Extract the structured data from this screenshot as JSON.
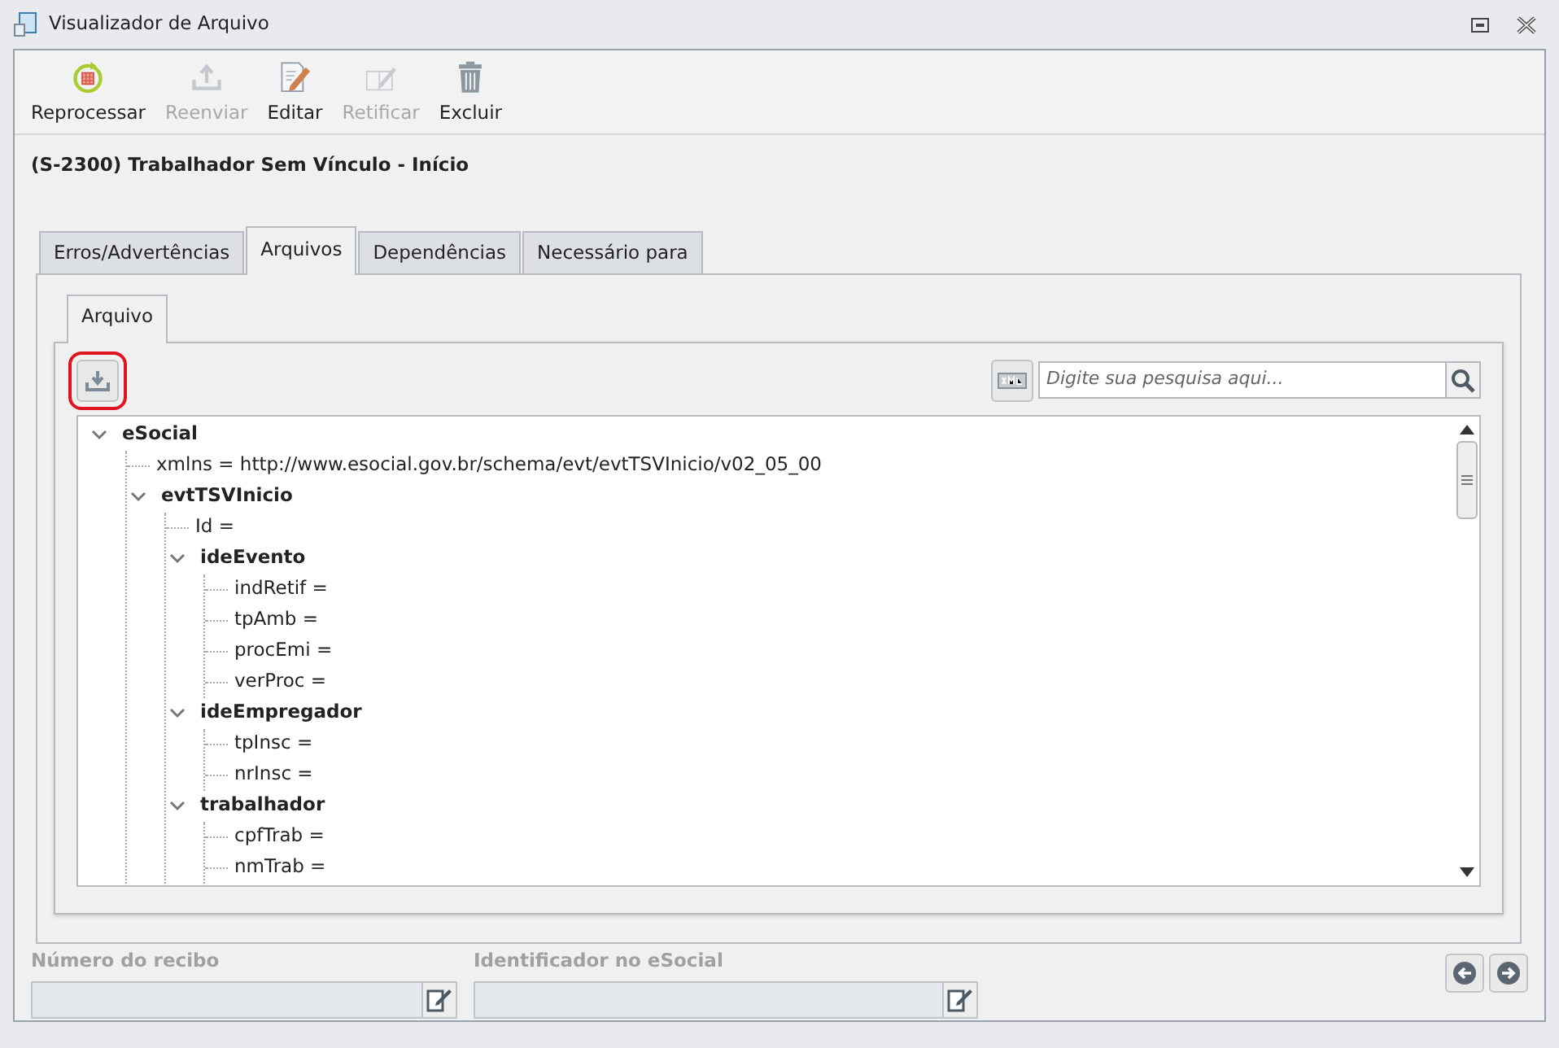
{
  "window": {
    "title": "Visualizador de Arquivo"
  },
  "toolbar": [
    {
      "kind": "reprocess",
      "label": "Reprocessar",
      "disabled": false
    },
    {
      "kind": "upload",
      "label": "Reenviar",
      "disabled": true
    },
    {
      "kind": "edit",
      "label": "Editar",
      "disabled": false
    },
    {
      "kind": "rectify",
      "label": "Retificar",
      "disabled": true
    },
    {
      "kind": "delete",
      "label": "Excluir",
      "disabled": false
    }
  ],
  "heading": "(S-2300) Trabalhador Sem Vínculo - Início",
  "tabs": [
    {
      "label": "Erros/Advertências",
      "selected": false
    },
    {
      "label": "Arquivos",
      "selected": true
    },
    {
      "label": "Dependências",
      "selected": false
    },
    {
      "label": "Necessário para",
      "selected": false
    }
  ],
  "inner_tabs": [
    {
      "label": "Arquivo",
      "selected": true
    }
  ],
  "search": {
    "placeholder": "Digite sua pesquisa aqui..."
  },
  "tree": [
    {
      "label": "eSocial",
      "expanded": true,
      "children": [
        {
          "label": "xmlns = http://www.esocial.gov.br/schema/evt/evtTSVInicio/v02_05_00"
        },
        {
          "label": "evtTSVInicio",
          "expanded": true,
          "children": [
            {
              "label": "Id ="
            },
            {
              "label": "ideEvento",
              "expanded": true,
              "children": [
                {
                  "label": "indRetif ="
                },
                {
                  "label": "tpAmb ="
                },
                {
                  "label": "procEmi ="
                },
                {
                  "label": "verProc ="
                }
              ]
            },
            {
              "label": "ideEmpregador",
              "expanded": true,
              "children": [
                {
                  "label": "tpInsc ="
                },
                {
                  "label": "nrInsc ="
                }
              ]
            },
            {
              "label": "trabalhador",
              "expanded": true,
              "children": [
                {
                  "label": "cpfTrab ="
                },
                {
                  "label": "nmTrab ="
                }
              ]
            }
          ]
        }
      ]
    }
  ],
  "fields": [
    {
      "label": "Número do recibo",
      "disabled": true
    },
    {
      "label": "Identificador no eSocial",
      "disabled": true
    }
  ]
}
